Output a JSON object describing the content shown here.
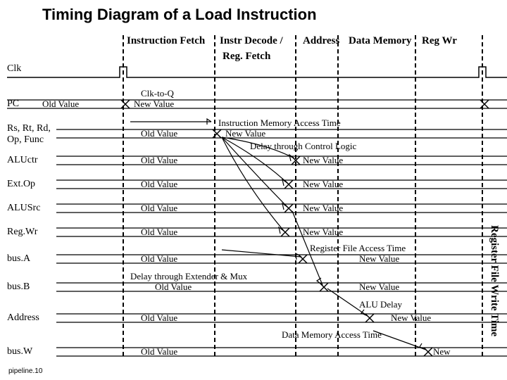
{
  "title": "Timing Diagram of a Load Instruction",
  "stages": {
    "fetch": "Instruction Fetch",
    "decode": "Instr Decode /",
    "regfetch": "Reg. Fetch",
    "address": "Address",
    "datamem": "Data Memory",
    "regwr": "Reg Wr"
  },
  "rows": {
    "clk": "Clk",
    "pc": "PC",
    "rs": "Rs, Rt, Rd,\nOp, Func",
    "aluctr": "ALUctr",
    "extop": "Ext.Op",
    "alusrc": "ALUSrc",
    "regwr": "Reg.Wr",
    "busA": "bus.A",
    "busB": "bus.B",
    "address": "Address",
    "busW": "bus.W"
  },
  "vals": {
    "old": "Old Value",
    "new": "New Value",
    "newshort": "New",
    "clktoq": "Clk-to-Q",
    "imem": "Instruction Memory Access Time",
    "ctrl": "Delay through Control Logic",
    "regacc": "Register File Access Time",
    "extmux": "Delay through Extender & Mux",
    "aludelay": "ALU Delay",
    "dmem": "Data Memory Access Time"
  },
  "side": "Register File Write Time",
  "footer": "pipeline.10"
}
